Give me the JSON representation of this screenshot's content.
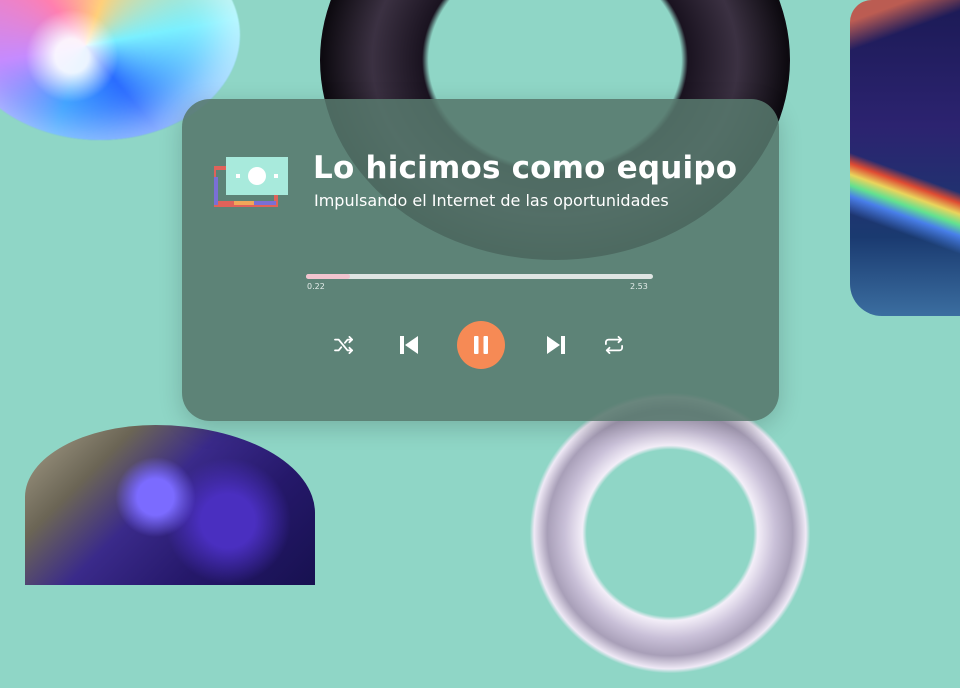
{
  "player": {
    "title": "Lo hicimos como equipo",
    "subtitle": "Impulsando el Internet de las oportunidades",
    "progress": {
      "current": "0.22",
      "total": "2.53",
      "fraction": 0.0
    },
    "icons": {
      "logo": "cash-stack-icon",
      "shuffle": "shuffle-icon",
      "previous": "skip-previous-icon",
      "play_pause": "pause-icon",
      "next": "skip-next-icon",
      "repeat": "repeat-icon"
    },
    "colors": {
      "background": "#8fd6c6",
      "card": "#56786c",
      "accent": "#f68a55",
      "progress": "#f3c4cf"
    }
  }
}
